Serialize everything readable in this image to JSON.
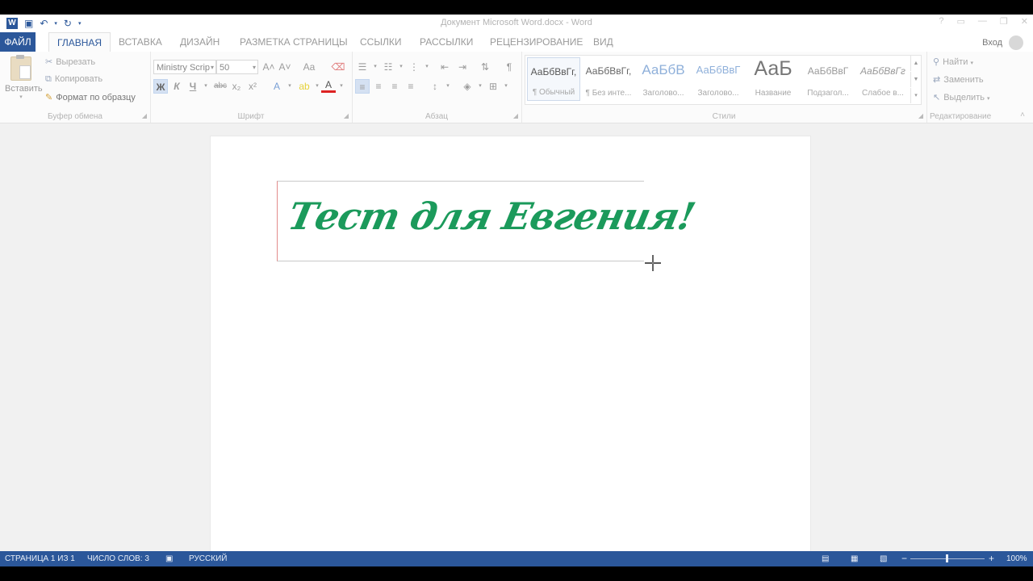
{
  "window": {
    "title": "Документ Microsoft Word.docx - Word",
    "app_icon_letter": "W",
    "controls": [
      "?",
      "▭",
      "—",
      "❐",
      "✕"
    ]
  },
  "tabs": {
    "file": "ФАЙЛ",
    "home": "ГЛАВНАЯ",
    "insert": "ВСТАВКА",
    "design": "ДИЗАЙН",
    "layout": "РАЗМЕТКА СТРАНИЦЫ",
    "references": "ССЫЛКИ",
    "mailings": "РАССЫЛКИ",
    "review": "РЕЦЕНЗИРОВАНИЕ",
    "view": "ВИД",
    "signin": "Вход"
  },
  "clipboard": {
    "paste": "Вставить",
    "cut": "Вырезать",
    "copy": "Копировать",
    "format_painter": "Формат по образцу",
    "label": "Буфер обмена"
  },
  "font": {
    "name": "Ministry Scrip",
    "size": "50",
    "label": "Шрифт",
    "bold": "Ж",
    "italic": "К",
    "underline": "Ч",
    "strike": "abc",
    "subscript": "x₂",
    "superscript": "x²",
    "grow": "A˄",
    "shrink": "A˅",
    "case": "Aa"
  },
  "paragraph": {
    "label": "Абзац"
  },
  "styles": {
    "label": "Стили",
    "items": [
      {
        "sample": "АаБбВвГг,",
        "name": "¶ Обычный"
      },
      {
        "sample": "АаБбВвГг,",
        "name": "¶ Без инте..."
      },
      {
        "sample": "АаБбВ",
        "name": "Заголово..."
      },
      {
        "sample": "АаБбВвГ",
        "name": "Заголово..."
      },
      {
        "sample": "АаБ",
        "name": "Название"
      },
      {
        "sample": "АаБбВвГ",
        "name": "Подзагол..."
      },
      {
        "sample": "АаБбВвГг",
        "name": "Слабое в..."
      }
    ]
  },
  "editing": {
    "label": "Редактирование",
    "find": "Найти",
    "replace": "Заменить",
    "select": "Выделить"
  },
  "document": {
    "wordart_text": "Тест для Евгения!",
    "wordart_color": "#1b9a5b"
  },
  "status": {
    "page": "СТРАНИЦА 1 ИЗ 1",
    "words": "ЧИСЛО СЛОВ: 3",
    "language": "РУССКИЙ",
    "zoom": "100%",
    "zoom_minus": "−",
    "zoom_plus": "+"
  },
  "colors": {
    "accent": "#2b579a",
    "text_green": "#1b9a5b"
  }
}
